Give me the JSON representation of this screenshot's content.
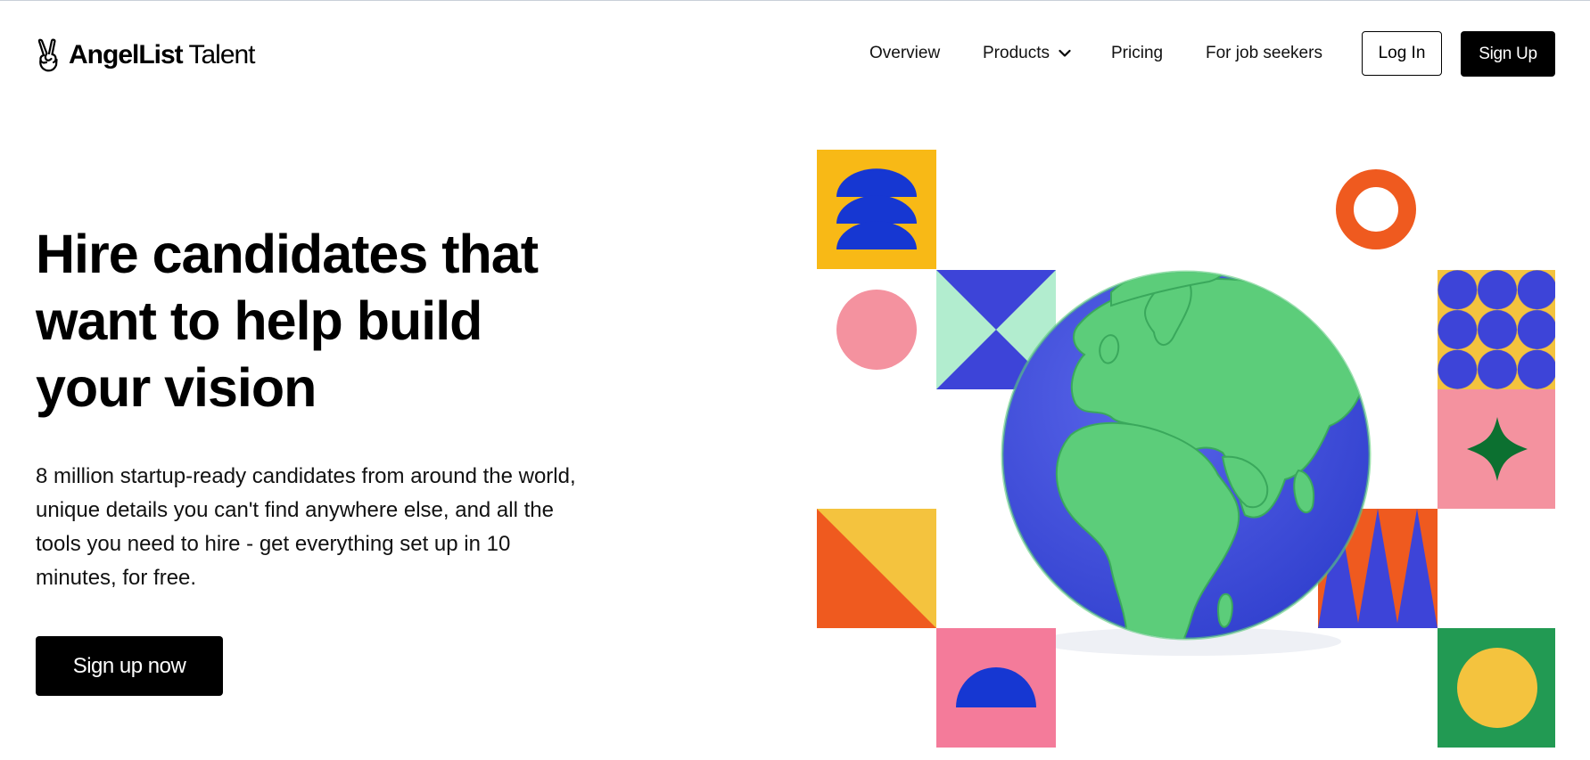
{
  "brand": {
    "name_bold": "AngelList",
    "name_light": " Talent",
    "logo_icon": "victory-hand-icon"
  },
  "nav": {
    "overview": "Overview",
    "products": "Products",
    "pricing": "Pricing",
    "job_seekers": "For job seekers",
    "login": "Log In",
    "signup": "Sign Up"
  },
  "hero": {
    "title": "Hire candidates that want to help build your vision",
    "subtitle": "8 million startup-ready candidates from around the world, unique details you can't find anywhere else, and all the tools you need to hire - get everything set up in 10 minutes, for free.",
    "cta": "Sign up now"
  },
  "illustration": {
    "description_icon": "globe-icon",
    "colors": {
      "yellow": "#f8b916",
      "blue": "#3d44d8",
      "deep_blue": "#1637d2",
      "pink": "#f4929f",
      "mint": "#b2edcf",
      "orange": "#ef5a1f",
      "light_yellow": "#f4c33e",
      "dark_green": "#0c7030",
      "green": "#229a53",
      "land": "#5ccd7a",
      "ocean": "#4352db"
    }
  }
}
